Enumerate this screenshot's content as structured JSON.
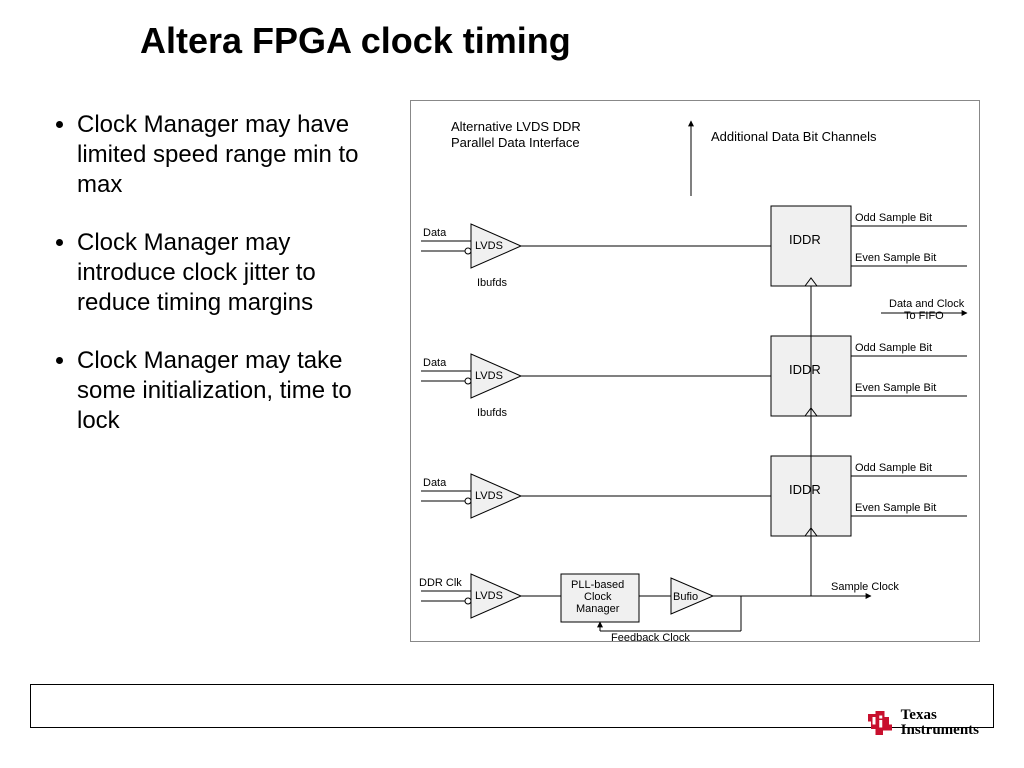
{
  "title": "Altera FPGA clock timing",
  "bullets": [
    "Clock Manager may have limited speed range min to max",
    "Clock Manager may introduce clock jitter to reduce timing margins",
    "Clock Manager may take some initialization, time to lock"
  ],
  "diagram": {
    "header_left_1": "Alternative LVDS DDR",
    "header_left_2": "Parallel Data Interface",
    "header_right": "Additional Data Bit Channels",
    "data_label": "Data",
    "ddr_clk_label": "DDR Clk",
    "lvds_label": "LVDS",
    "ibufds_label": "Ibufds",
    "iddr_label": "IDDR",
    "odd_label": "Odd Sample Bit",
    "even_label": "Even Sample Bit",
    "fifo_label_1": "Data and Clock",
    "fifo_label_2": "To FIFO",
    "pll_line1": "PLL-based",
    "pll_line2": "Clock",
    "pll_line3": "Manager",
    "bufio_label": "Bufio",
    "feedback_label": "Feedback Clock",
    "sample_label": "Sample Clock"
  },
  "logo": {
    "line1": "Texas",
    "line2": "Instruments"
  }
}
